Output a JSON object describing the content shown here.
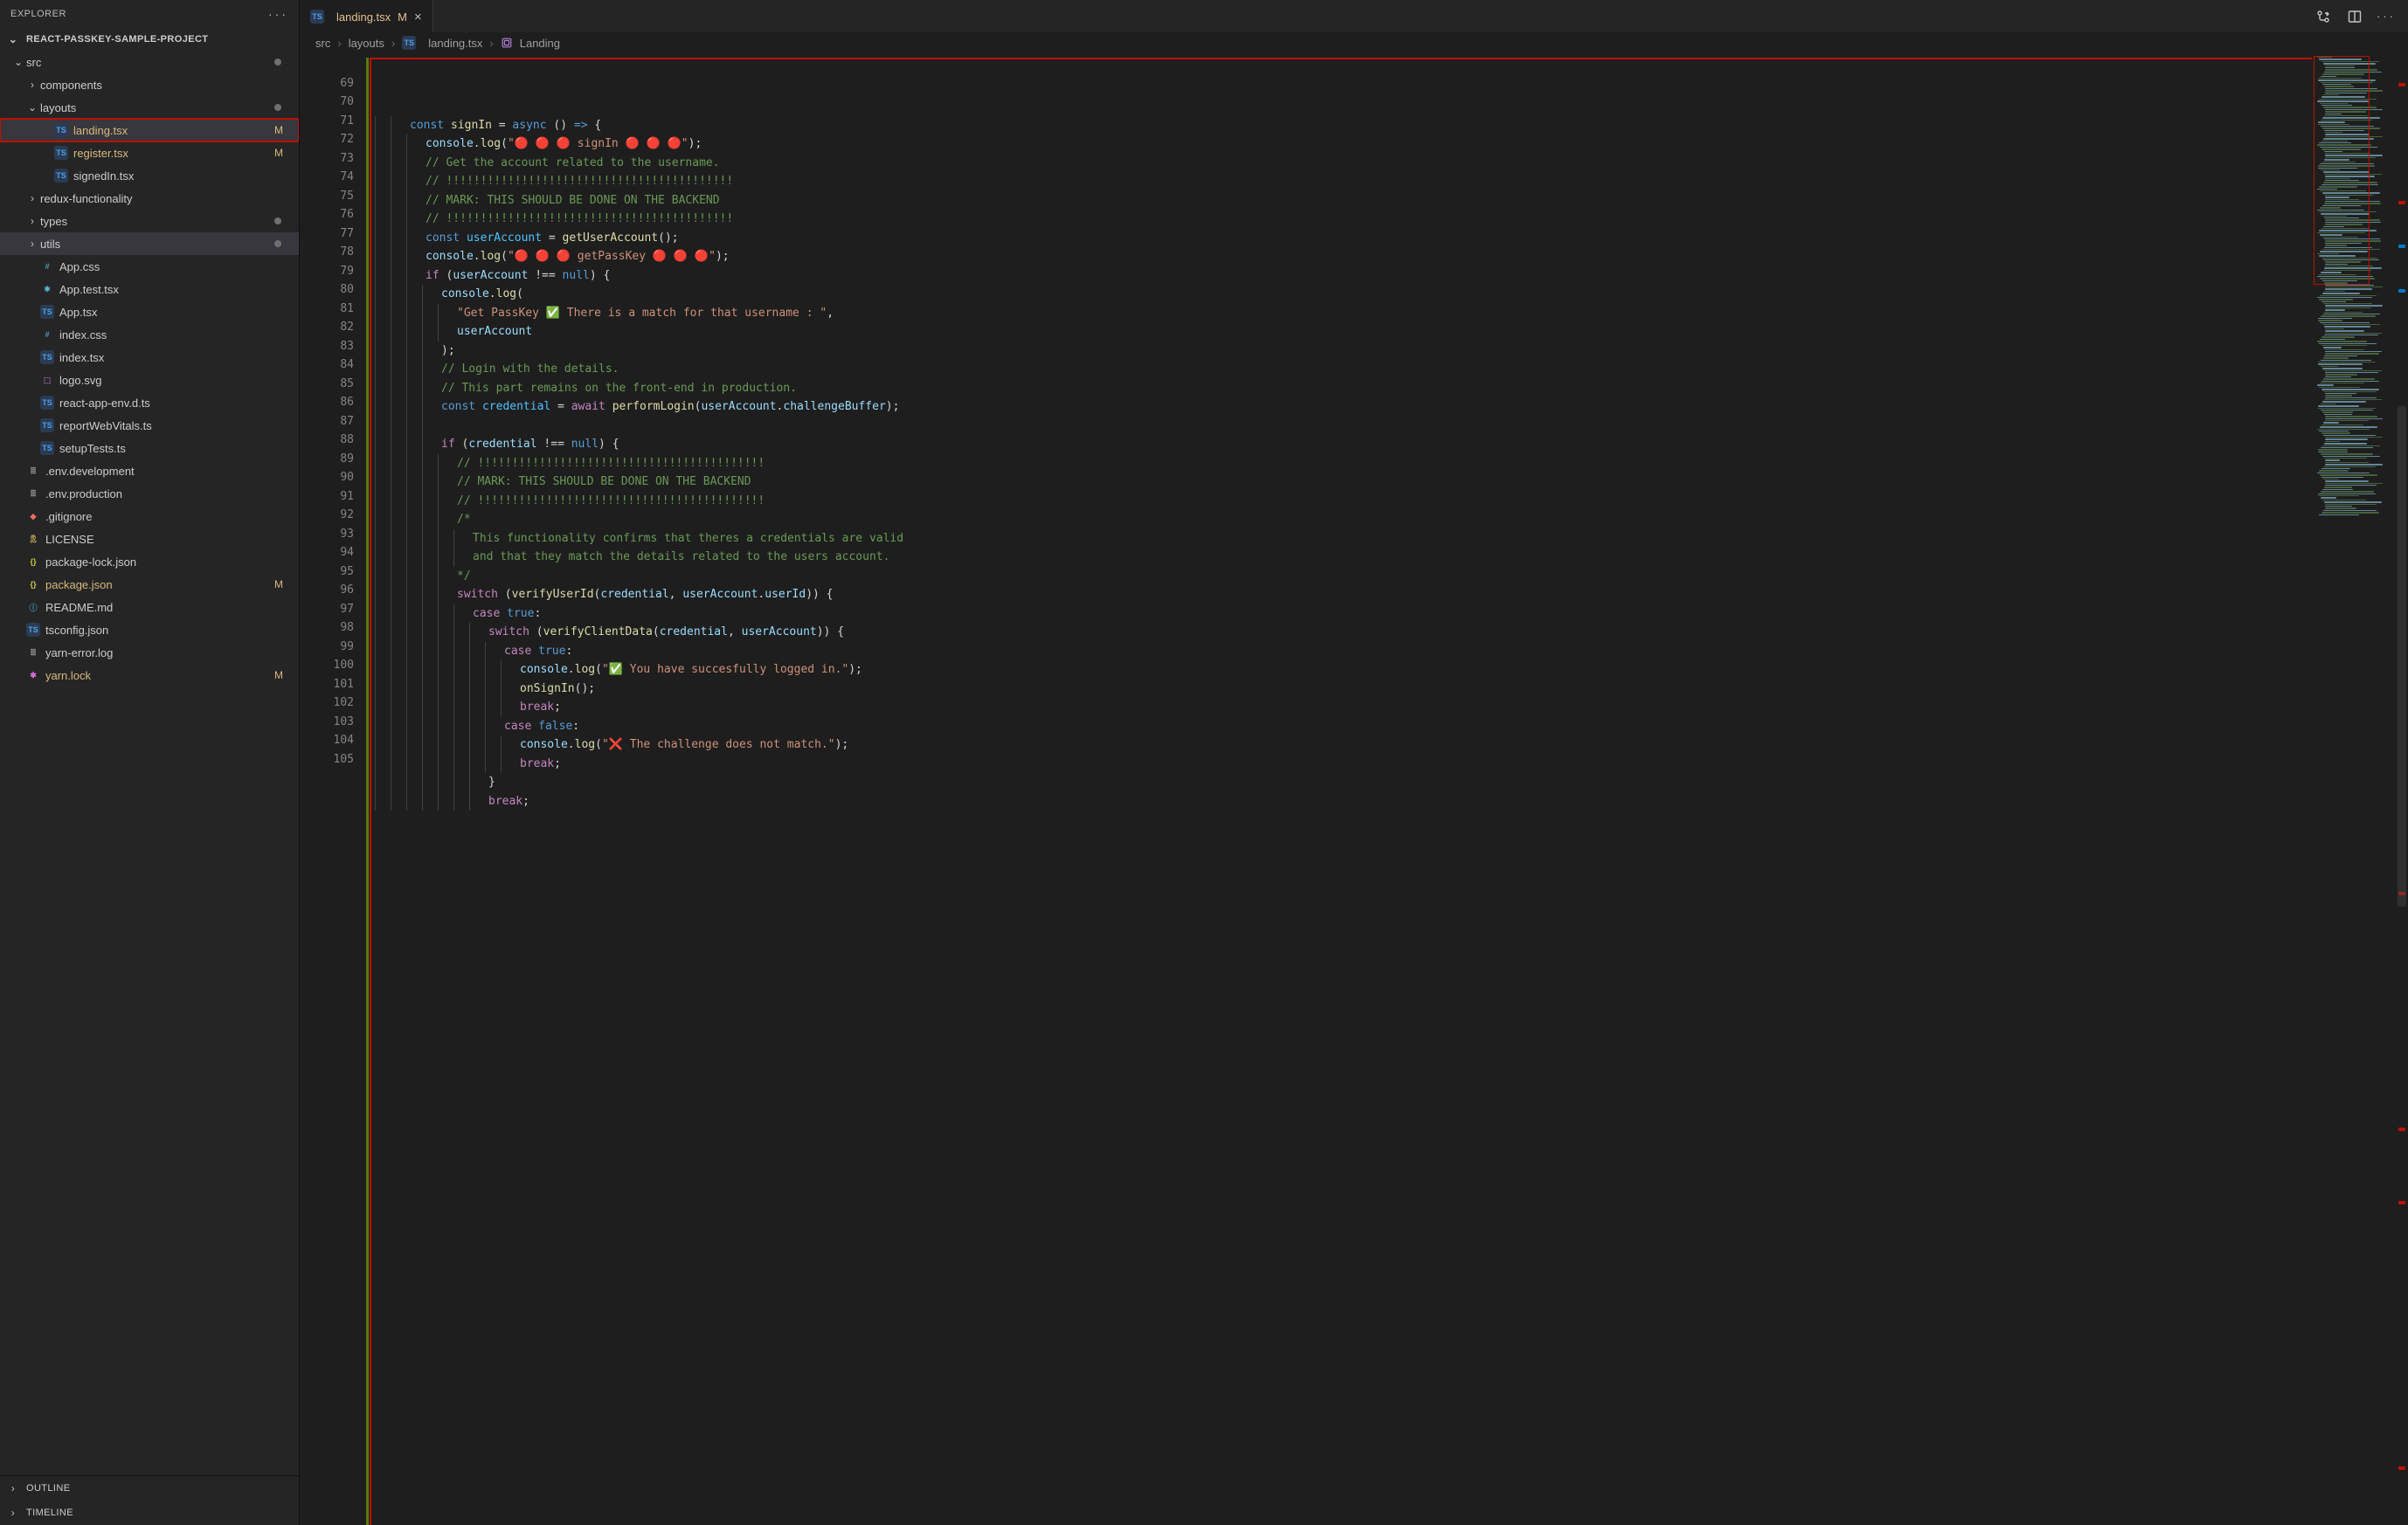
{
  "sidebar": {
    "title": "EXPLORER",
    "root": "REACT-PASSKEY-SAMPLE-PROJECT",
    "tree": [
      {
        "depth": 0,
        "kind": "folder",
        "open": true,
        "label": "src",
        "dot": true
      },
      {
        "depth": 1,
        "kind": "folder",
        "open": false,
        "label": "components"
      },
      {
        "depth": 1,
        "kind": "folder",
        "open": true,
        "label": "layouts",
        "dot": true
      },
      {
        "depth": 2,
        "kind": "file",
        "icon": "ts",
        "label": "landing.tsx",
        "badge": "M",
        "hi": true,
        "sel": true
      },
      {
        "depth": 2,
        "kind": "file",
        "icon": "ts",
        "label": "register.tsx",
        "badge": "M"
      },
      {
        "depth": 2,
        "kind": "file",
        "icon": "ts",
        "label": "signedIn.tsx"
      },
      {
        "depth": 1,
        "kind": "folder",
        "open": false,
        "label": "redux-functionality"
      },
      {
        "depth": 1,
        "kind": "folder",
        "open": false,
        "label": "types",
        "dot": true
      },
      {
        "depth": 1,
        "kind": "folder",
        "open": false,
        "label": "utils",
        "dot": true,
        "sel": true
      },
      {
        "depth": 1,
        "kind": "file",
        "icon": "css",
        "label": "App.css"
      },
      {
        "depth": 1,
        "kind": "file",
        "icon": "react",
        "label": "App.test.tsx"
      },
      {
        "depth": 1,
        "kind": "file",
        "icon": "ts",
        "label": "App.tsx"
      },
      {
        "depth": 1,
        "kind": "file",
        "icon": "css",
        "label": "index.css"
      },
      {
        "depth": 1,
        "kind": "file",
        "icon": "ts",
        "label": "index.tsx"
      },
      {
        "depth": 1,
        "kind": "file",
        "icon": "svg",
        "label": "logo.svg"
      },
      {
        "depth": 1,
        "kind": "file",
        "icon": "ts",
        "label": "react-app-env.d.ts"
      },
      {
        "depth": 1,
        "kind": "file",
        "icon": "ts",
        "label": "reportWebVitals.ts"
      },
      {
        "depth": 1,
        "kind": "file",
        "icon": "ts",
        "label": "setupTests.ts"
      },
      {
        "depth": 0,
        "kind": "file",
        "icon": "env",
        "label": ".env.development"
      },
      {
        "depth": 0,
        "kind": "file",
        "icon": "env",
        "label": ".env.production"
      },
      {
        "depth": 0,
        "kind": "file",
        "icon": "git",
        "label": ".gitignore"
      },
      {
        "depth": 0,
        "kind": "file",
        "icon": "lic",
        "label": "LICENSE"
      },
      {
        "depth": 0,
        "kind": "file",
        "icon": "json",
        "label": "package-lock.json"
      },
      {
        "depth": 0,
        "kind": "file",
        "icon": "json",
        "label": "package.json",
        "badge": "M"
      },
      {
        "depth": 0,
        "kind": "file",
        "icon": "md",
        "label": "README.md"
      },
      {
        "depth": 0,
        "kind": "file",
        "icon": "ts",
        "label": "tsconfig.json"
      },
      {
        "depth": 0,
        "kind": "file",
        "icon": "env",
        "label": "yarn-error.log"
      },
      {
        "depth": 0,
        "kind": "file",
        "icon": "lock",
        "label": "yarn.lock",
        "badge": "M"
      }
    ],
    "bottom": [
      "OUTLINE",
      "TIMELINE"
    ]
  },
  "tab": {
    "icon": "TS",
    "name": "landing.tsx",
    "badge": "M"
  },
  "breadcrumbs": [
    {
      "label": "src"
    },
    {
      "label": "layouts"
    },
    {
      "icon": "TS",
      "label": "landing.tsx"
    },
    {
      "icon": "sym",
      "label": "Landing"
    }
  ],
  "code": {
    "first_partial": 68,
    "start": 69,
    "lines": [
      {
        "n": 69,
        "ind": 2,
        "tokens": [
          [
            "kw",
            "const "
          ],
          [
            "fn",
            "signIn"
          ],
          [
            "pn",
            " = "
          ],
          [
            "kw",
            "async"
          ],
          [
            "pn",
            " () "
          ],
          [
            "kw",
            "=>"
          ],
          [
            "pn",
            " {"
          ]
        ]
      },
      {
        "n": 70,
        "ind": 3,
        "tokens": [
          [
            "vr",
            "console"
          ],
          [
            "pn",
            "."
          ],
          [
            "fn",
            "log"
          ],
          [
            "pn",
            "("
          ],
          [
            "str",
            "\"🔴 🔴 🔴 signIn 🔴 🔴 🔴\""
          ],
          [
            "pn",
            ");"
          ]
        ]
      },
      {
        "n": 71,
        "ind": 3,
        "tokens": [
          [
            "cm",
            "// Get the account related to the username."
          ]
        ]
      },
      {
        "n": 72,
        "ind": 3,
        "tokens": [
          [
            "cm",
            "// !!!!!!!!!!!!!!!!!!!!!!!!!!!!!!!!!!!!!!!!!!"
          ]
        ]
      },
      {
        "n": 73,
        "ind": 3,
        "tokens": [
          [
            "cm",
            "// MARK: THIS SHOULD BE DONE ON THE BACKEND"
          ]
        ]
      },
      {
        "n": 74,
        "ind": 3,
        "tokens": [
          [
            "cm",
            "// !!!!!!!!!!!!!!!!!!!!!!!!!!!!!!!!!!!!!!!!!!"
          ]
        ]
      },
      {
        "n": 75,
        "ind": 3,
        "tokens": [
          [
            "kw",
            "const "
          ],
          [
            "cn",
            "userAccount"
          ],
          [
            "pn",
            " = "
          ],
          [
            "fn",
            "getUserAccount"
          ],
          [
            "pn",
            "();"
          ]
        ]
      },
      {
        "n": 76,
        "ind": 3,
        "tokens": [
          [
            "vr",
            "console"
          ],
          [
            "pn",
            "."
          ],
          [
            "fn",
            "log"
          ],
          [
            "pn",
            "("
          ],
          [
            "str",
            "\"🔴 🔴 🔴 getPassKey 🔴 🔴 🔴\""
          ],
          [
            "pn",
            ");"
          ]
        ]
      },
      {
        "n": 77,
        "ind": 3,
        "tokens": [
          [
            "pu",
            "if"
          ],
          [
            "pn",
            " ("
          ],
          [
            "vr",
            "userAccount"
          ],
          [
            "pn",
            " !== "
          ],
          [
            "kw",
            "null"
          ],
          [
            "pn",
            ") {"
          ]
        ]
      },
      {
        "n": 78,
        "ind": 4,
        "tokens": [
          [
            "vr",
            "console"
          ],
          [
            "pn",
            "."
          ],
          [
            "fn",
            "log"
          ],
          [
            "pn",
            "("
          ]
        ]
      },
      {
        "n": 79,
        "ind": 5,
        "tokens": [
          [
            "str",
            "\"Get PassKey ✅ There is a match for that username : \""
          ],
          [
            "pn",
            ","
          ]
        ]
      },
      {
        "n": 80,
        "ind": 5,
        "tokens": [
          [
            "vr",
            "userAccount"
          ]
        ]
      },
      {
        "n": 81,
        "ind": 4,
        "tokens": [
          [
            "pn",
            ");"
          ]
        ]
      },
      {
        "n": 82,
        "ind": 4,
        "tokens": [
          [
            "cm",
            "// Login with the details."
          ]
        ]
      },
      {
        "n": 83,
        "ind": 4,
        "tokens": [
          [
            "cm",
            "// This part remains on the front-end in production."
          ]
        ]
      },
      {
        "n": 84,
        "ind": 4,
        "tokens": [
          [
            "kw",
            "const "
          ],
          [
            "cn",
            "credential"
          ],
          [
            "pn",
            " = "
          ],
          [
            "pu",
            "await"
          ],
          [
            "pn",
            " "
          ],
          [
            "fn",
            "performLogin"
          ],
          [
            "pn",
            "("
          ],
          [
            "vr",
            "userAccount"
          ],
          [
            "pn",
            "."
          ],
          [
            "vr",
            "challengeBuffer"
          ],
          [
            "pn",
            ");"
          ]
        ]
      },
      {
        "n": 85,
        "ind": 4,
        "tokens": []
      },
      {
        "n": 86,
        "ind": 4,
        "tokens": [
          [
            "pu",
            "if"
          ],
          [
            "pn",
            " ("
          ],
          [
            "vr",
            "credential"
          ],
          [
            "pn",
            " !== "
          ],
          [
            "kw",
            "null"
          ],
          [
            "pn",
            ") {"
          ]
        ]
      },
      {
        "n": 87,
        "ind": 5,
        "tokens": [
          [
            "cm",
            "// !!!!!!!!!!!!!!!!!!!!!!!!!!!!!!!!!!!!!!!!!!"
          ]
        ]
      },
      {
        "n": 88,
        "ind": 5,
        "tokens": [
          [
            "cm",
            "// MARK: THIS SHOULD BE DONE ON THE BACKEND"
          ]
        ]
      },
      {
        "n": 89,
        "ind": 5,
        "tokens": [
          [
            "cm",
            "// !!!!!!!!!!!!!!!!!!!!!!!!!!!!!!!!!!!!!!!!!!"
          ]
        ]
      },
      {
        "n": 90,
        "ind": 5,
        "tokens": [
          [
            "cm",
            "/*"
          ]
        ]
      },
      {
        "n": 91,
        "ind": 6,
        "tokens": [
          [
            "cm",
            "This functionality confirms that theres a credentials are valid"
          ]
        ]
      },
      {
        "n": 92,
        "ind": 6,
        "tokens": [
          [
            "cm",
            "and that they match the details related to the users account."
          ]
        ]
      },
      {
        "n": 93,
        "ind": 5,
        "tokens": [
          [
            "cm",
            "*/"
          ]
        ]
      },
      {
        "n": 94,
        "ind": 5,
        "tokens": [
          [
            "pu",
            "switch"
          ],
          [
            "pn",
            " ("
          ],
          [
            "fn",
            "verifyUserId"
          ],
          [
            "pn",
            "("
          ],
          [
            "vr",
            "credential"
          ],
          [
            "pn",
            ", "
          ],
          [
            "vr",
            "userAccount"
          ],
          [
            "pn",
            "."
          ],
          [
            "vr",
            "userId"
          ],
          [
            "pn",
            ")) {"
          ]
        ]
      },
      {
        "n": 95,
        "ind": 6,
        "tokens": [
          [
            "pu",
            "case"
          ],
          [
            "pn",
            " "
          ],
          [
            "kw",
            "true"
          ],
          [
            "pn",
            ":"
          ]
        ]
      },
      {
        "n": 96,
        "ind": 7,
        "tokens": [
          [
            "pu",
            "switch"
          ],
          [
            "pn",
            " ("
          ],
          [
            "fn",
            "verifyClientData"
          ],
          [
            "pn",
            "("
          ],
          [
            "vr",
            "credential"
          ],
          [
            "pn",
            ", "
          ],
          [
            "vr",
            "userAccount"
          ],
          [
            "pn",
            ")) {"
          ]
        ]
      },
      {
        "n": 97,
        "ind": 8,
        "tokens": [
          [
            "pu",
            "case"
          ],
          [
            "pn",
            " "
          ],
          [
            "kw",
            "true"
          ],
          [
            "pn",
            ":"
          ]
        ]
      },
      {
        "n": 98,
        "ind": 9,
        "tokens": [
          [
            "vr",
            "console"
          ],
          [
            "pn",
            "."
          ],
          [
            "fn",
            "log"
          ],
          [
            "pn",
            "("
          ],
          [
            "str",
            "\"✅ You have succesfully logged in.\""
          ],
          [
            "pn",
            ");"
          ]
        ]
      },
      {
        "n": 99,
        "ind": 9,
        "tokens": [
          [
            "fn",
            "onSignIn"
          ],
          [
            "pn",
            "();"
          ]
        ]
      },
      {
        "n": 100,
        "ind": 9,
        "tokens": [
          [
            "pu",
            "break"
          ],
          [
            "pn",
            ";"
          ]
        ]
      },
      {
        "n": 101,
        "ind": 8,
        "tokens": [
          [
            "pu",
            "case"
          ],
          [
            "pn",
            " "
          ],
          [
            "kw",
            "false"
          ],
          [
            "pn",
            ":"
          ]
        ]
      },
      {
        "n": 102,
        "ind": 9,
        "tokens": [
          [
            "vr",
            "console"
          ],
          [
            "pn",
            "."
          ],
          [
            "fn",
            "log"
          ],
          [
            "pn",
            "("
          ],
          [
            "str",
            "\"❌ The challenge does not match.\""
          ],
          [
            "pn",
            ");"
          ]
        ]
      },
      {
        "n": 103,
        "ind": 9,
        "tokens": [
          [
            "pu",
            "break"
          ],
          [
            "pn",
            ";"
          ]
        ]
      },
      {
        "n": 104,
        "ind": 7,
        "tokens": [
          [
            "pn",
            "}"
          ]
        ]
      },
      {
        "n": 105,
        "ind": 7,
        "tokens": [
          [
            "pu",
            "break"
          ],
          [
            "pn",
            ";"
          ]
        ]
      }
    ]
  },
  "icons": {
    "compare": "compare-icon",
    "split": "split-icon",
    "more": "more-icon"
  }
}
